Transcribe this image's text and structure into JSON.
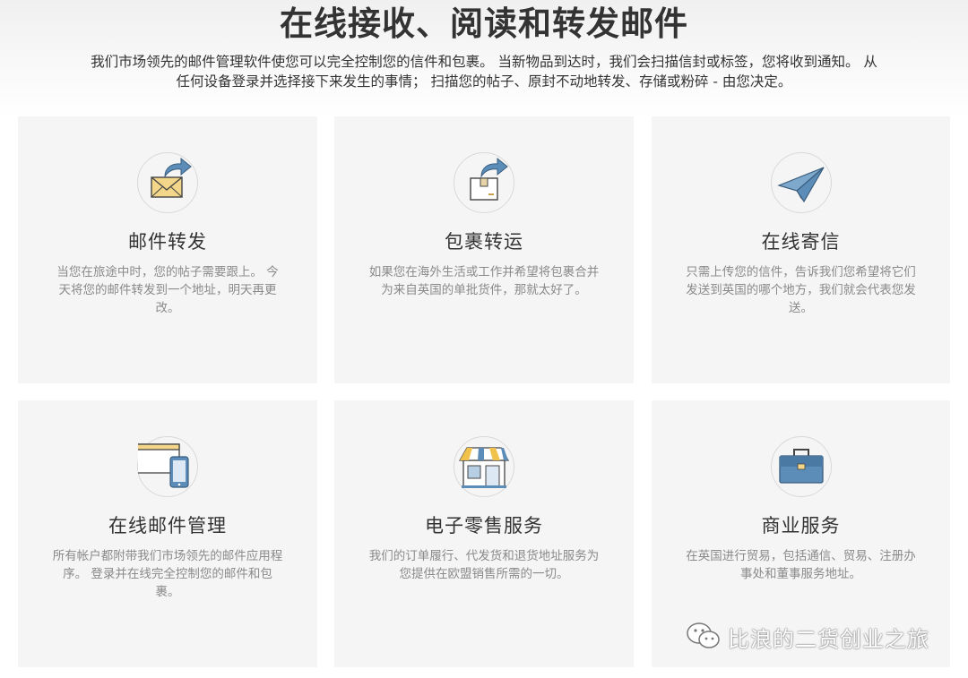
{
  "header": {
    "title": "在线接收、阅读和转发邮件",
    "description_line1": "我们市场领先的邮件管理软件使您可以完全控制您的信件和包裹。 当新物品到达时，我们会扫描信封或标签，您将收到通知。 从",
    "description_line2": "任何设备登录并选择接下来发生的事情； 扫描您的帖子、原封不动地转发、存储或粉碎 - 由您决定。"
  },
  "cards": [
    {
      "icon": "envelope-forward-icon",
      "title": "邮件转发",
      "lines": [
        "当您在旅途中时，您的帖子需要跟上。 今",
        "天将您的邮件转发到一个地址，明天再更",
        "改。"
      ]
    },
    {
      "icon": "parcel-forward-icon",
      "title": "包裹转运",
      "lines": [
        "如果您在海外生活或工作并希望将包裹合并",
        "为来自英国的单批货件，那就太好了。"
      ]
    },
    {
      "icon": "paper-plane-icon",
      "title": "在线寄信",
      "lines": [
        "只需上传您的信件，告诉我们您希望将它们",
        "发送到英国的哪个地方，我们就会代表您发",
        "送。"
      ]
    },
    {
      "icon": "browser-phone-icon",
      "title": "在线邮件管理",
      "lines": [
        "所有帐户都附带我们市场领先的邮件应用程",
        "序。 登录并在线完全控制您的邮件和包",
        "裹。"
      ]
    },
    {
      "icon": "storefront-icon",
      "title": "电子零售服务",
      "lines": [
        "我们的订单履行、代发货和退货地址服务为",
        "您提供在欧盟销售所需的一切。"
      ]
    },
    {
      "icon": "briefcase-icon",
      "title": "商业服务",
      "lines": [
        "在英国进行贸易，包括通信、贸易、注册办",
        "事处和董事服务地址。"
      ]
    }
  ],
  "watermark": {
    "text": "比浪的二货创业之旅",
    "icon": "wechat-icon"
  },
  "colors": {
    "card_bg": "#f5f5f5",
    "icon_blue": "#5b8db8",
    "envelope_yellow": "#f3d68a",
    "awning_yellow": "#f0c24b"
  }
}
